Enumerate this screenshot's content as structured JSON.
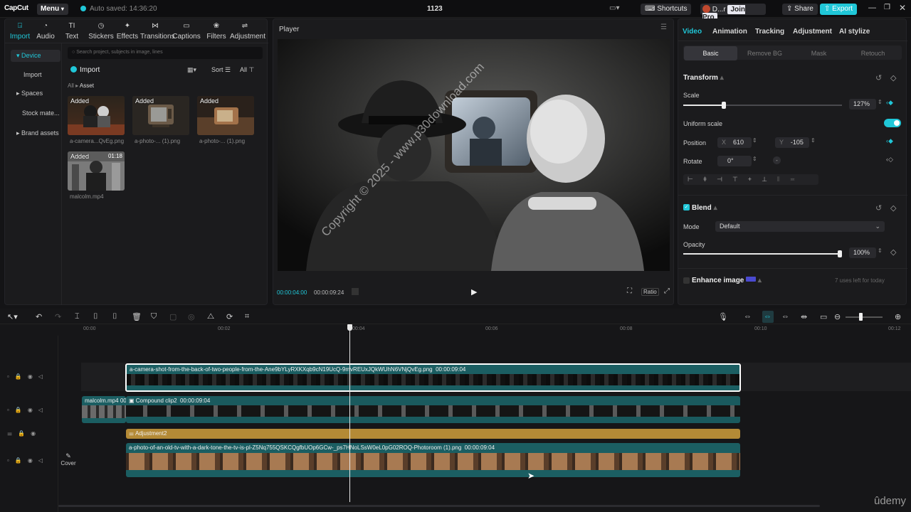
{
  "titlebar": {
    "logo": "CapCut",
    "menu_label": "Menu",
    "autosave": "Auto saved: 14:36:20",
    "project_name": "1123",
    "shortcuts_label": "Shortcuts",
    "user_label": "D...r",
    "join_pro_label": "Join Pro",
    "share_label": "Share",
    "export_label": "Export"
  },
  "toolbar": {
    "tabs": [
      "Import",
      "Audio",
      "Text",
      "Stickers",
      "Effects",
      "Transitions",
      "Captions",
      "Filters",
      "Adjustment"
    ],
    "active": "Import"
  },
  "media": {
    "sidebar": [
      "Device",
      "Import",
      "Spaces",
      "Stock mate...",
      "Brand assets"
    ],
    "search_placeholder": "Search project, subjects in image, lines",
    "import_label": "Import",
    "sort_label": "Sort",
    "all_label": "All",
    "breadcrumb_root": "All",
    "breadcrumb_current": "Asset",
    "items": [
      {
        "badge": "Added",
        "name": "a-camera...QvEg.png",
        "duration": ""
      },
      {
        "badge": "Added",
        "name": "a-photo-... (1).png",
        "duration": ""
      },
      {
        "badge": "Added",
        "name": "a-photo-... (1).png",
        "duration": ""
      },
      {
        "badge": "Added",
        "name": "malcolm.mp4",
        "duration": "01:18"
      }
    ]
  },
  "player": {
    "title": "Player",
    "current_time": "00:00:04:00",
    "total_time": "00:00:09:24",
    "ratio_label": "Ratio",
    "watermark": "Copyright © 2025 - www.p30download.com"
  },
  "properties": {
    "tabs": [
      "Video",
      "Animation",
      "Tracking",
      "Adjustment",
      "AI stylize"
    ],
    "active_tab": "Video",
    "subtabs": [
      "Basic",
      "Remove BG",
      "Mask",
      "Retouch"
    ],
    "active_subtab": "Basic",
    "transform_label": "Transform",
    "scale_label": "Scale",
    "scale_value": "127%",
    "scale_fraction": 0.127,
    "uniform_scale_label": "Uniform scale",
    "uniform_scale_on": true,
    "position_label": "Position",
    "pos_x_label": "X",
    "pos_x": "610",
    "pos_y_label": "Y",
    "pos_y": "-105",
    "rotate_label": "Rotate",
    "rotate_value": "0°",
    "blend_label": "Blend",
    "mode_label": "Mode",
    "mode_value": "Default",
    "opacity_label": "Opacity",
    "opacity_value": "100%",
    "opacity_fraction": 1.0,
    "enhance_label": "Enhance image",
    "enhance_note": "7 uses left for today"
  },
  "timeline": {
    "ruler": [
      "00:00",
      "00:02",
      "00:04",
      "00:06",
      "00:08",
      "00:10",
      "00:12"
    ],
    "cover_label": "Cover",
    "clips": {
      "main": {
        "name": "a-camera-shot-from-the-back-of-two-people-from-the-Ane9bYLyRXKXqb9cN19UcQ-9mvREUxJQkWUhN6VNjQvEg.png",
        "duration": "00:00:09:04"
      },
      "malcolm": {
        "name": "malcolm.mp4",
        "duration": "00"
      },
      "compound": {
        "name": "Compound clip2",
        "duration": "00:00:09:04"
      },
      "adjustment": {
        "name": "Adjustment2"
      },
      "photo": {
        "name": "a-photo-of-an-old-tv-with-a-dark-tone-the-tv-is-pl-Z5Nq755QSKCQgfbUOp6GCw-_ps7HNoLSsW0eL0pG02ROQ-Photoroom (1).png",
        "duration": "00:00:09:04"
      }
    }
  },
  "brand_watermark": "ûdemy",
  "colors": {
    "accent": "#20c7d8",
    "track_teal": "#1e6e6e",
    "adjustment": "#b48a36"
  }
}
